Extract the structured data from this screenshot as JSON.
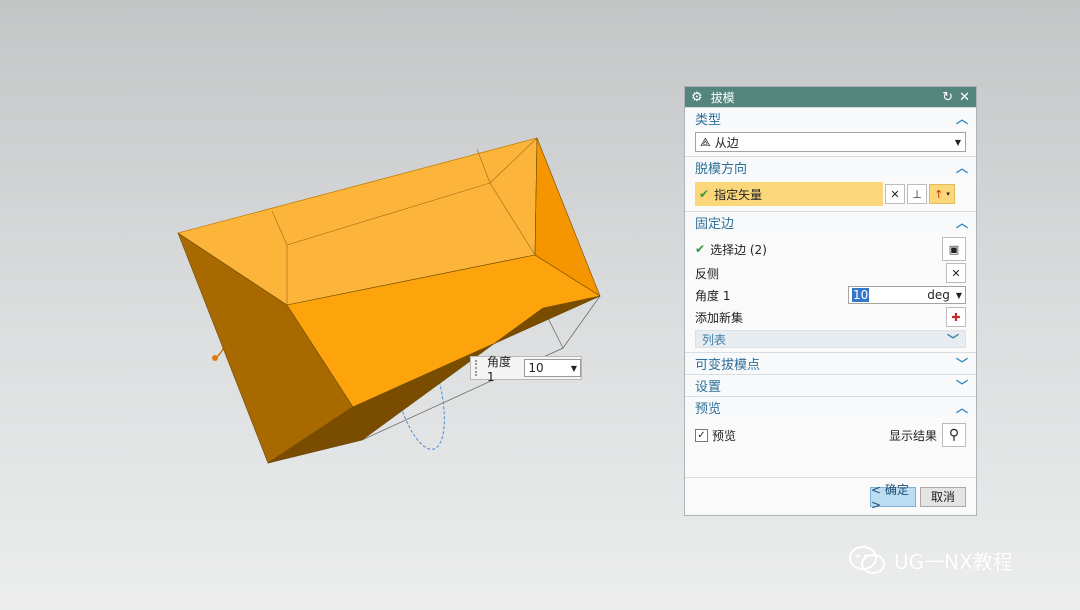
{
  "canvas": {
    "angle_label": "角度 1",
    "angle_value": "10"
  },
  "dialog": {
    "title": "拔模",
    "sections": {
      "type": {
        "header": "类型",
        "value": "从边"
      },
      "direction": {
        "header": "脱模方向",
        "vector_label": "指定矢量"
      },
      "fixed_edge": {
        "header": "固定边",
        "select_label": "选择边 (2)",
        "reverse_label": "反侧",
        "angle_label": "角度 1",
        "angle_value": "10",
        "angle_unit": "deg",
        "add_set_label": "添加新集",
        "list_label": "列表"
      },
      "variable": {
        "header": "可变拔模点"
      },
      "settings": {
        "header": "设置"
      },
      "preview": {
        "header": "预览",
        "checkbox_label": "预览",
        "show_result_label": "显示结果"
      }
    },
    "buttons": {
      "ok": "< 确定 >",
      "cancel": "取消"
    }
  },
  "watermark": {
    "text": "UG一NX教程"
  },
  "colors": {
    "titlebar": "#54857d",
    "section_header": "#2e6f98",
    "highlight": "#fbd77a",
    "body_face": "#fda30c"
  }
}
